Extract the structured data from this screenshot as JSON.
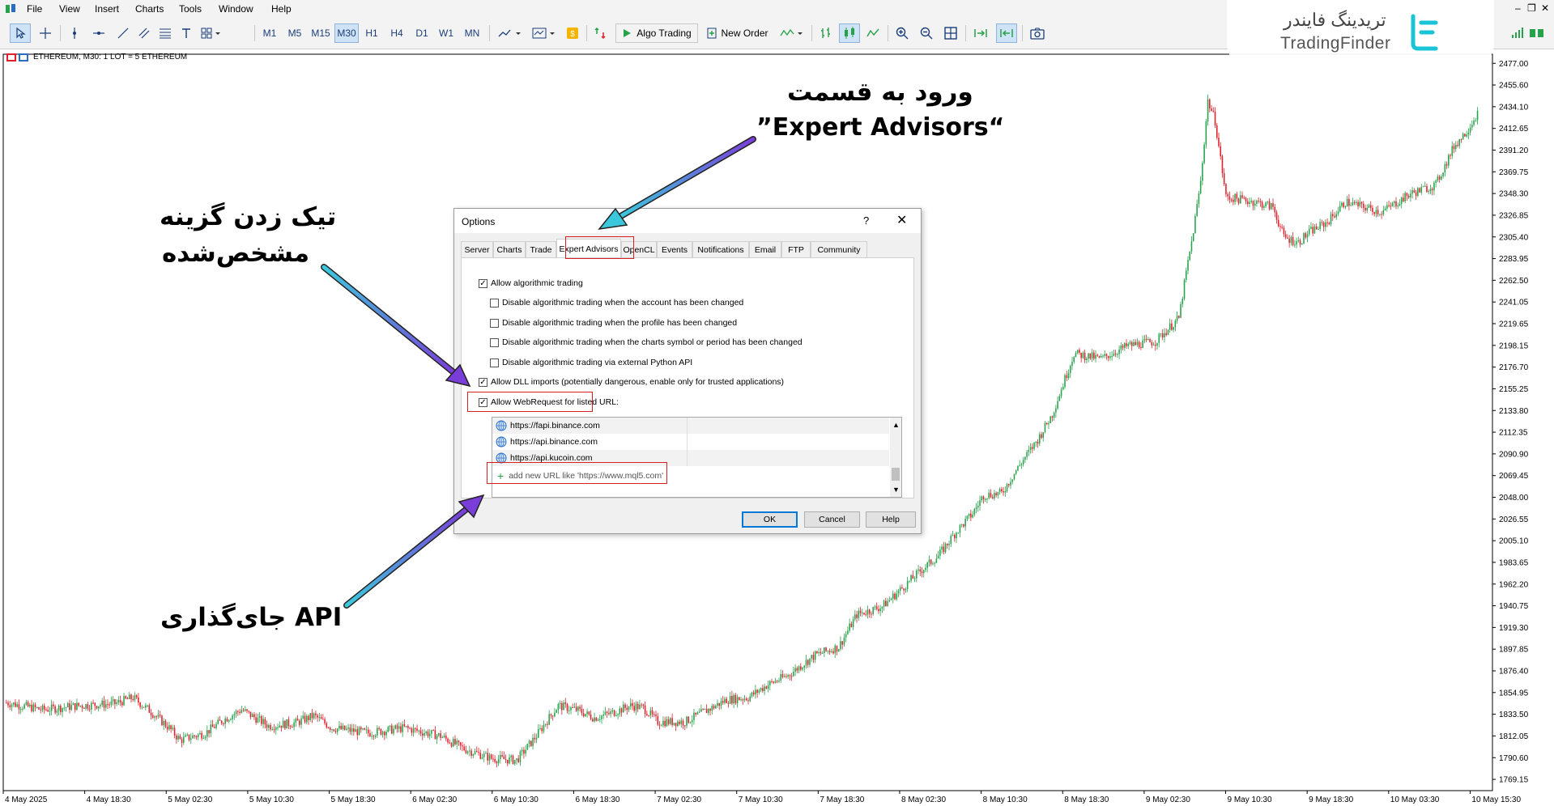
{
  "menu": [
    "File",
    "View",
    "Insert",
    "Charts",
    "Tools",
    "Window",
    "Help"
  ],
  "toolbar": {
    "timeframes": [
      "M1",
      "M5",
      "M15",
      "M30",
      "H1",
      "H4",
      "D1",
      "W1",
      "MN"
    ],
    "active_timeframe": "M30",
    "algo_trading": "Algo Trading",
    "new_order": "New Order"
  },
  "chart": {
    "symbol_label": "ETHEREUM, M30:  1 LOT = 5 ETHEREUM",
    "price_ticks": [
      "2477.00",
      "2455.60",
      "2434.10",
      "2412.65",
      "2391.20",
      "2369.75",
      "2348.30",
      "2326.85",
      "2305.40",
      "2283.95",
      "2262.50",
      "2241.05",
      "2219.65",
      "2198.15",
      "2176.70",
      "2155.25",
      "2133.80",
      "2112.35",
      "2090.90",
      "2069.45",
      "2048.00",
      "2026.55",
      "2005.10",
      "1983.65",
      "1962.20",
      "1940.75",
      "1919.30",
      "1897.85",
      "1876.40",
      "1854.95",
      "1833.50",
      "1812.05",
      "1790.60",
      "1769.15"
    ],
    "time_ticks": [
      "4 May 2025",
      "4 May 18:30",
      "5 May 02:30",
      "5 May 10:30",
      "5 May 18:30",
      "6 May 02:30",
      "6 May 10:30",
      "6 May 18:30",
      "7 May 02:30",
      "7 May 10:30",
      "7 May 18:30",
      "8 May 02:30",
      "8 May 10:30",
      "8 May 18:30",
      "9 May 02:30",
      "9 May 10:30",
      "9 May 18:30",
      "10 May 03:30",
      "10 May 15:30"
    ],
    "bull_color": "#26a24a",
    "bear_color": "#e0202a"
  },
  "chart_data": {
    "type": "candlestick",
    "symbol": "ETHEREUM",
    "timeframe": "M30",
    "ylim": [
      1758,
      2486
    ],
    "close_path": [
      [
        0,
        1845
      ],
      [
        20,
        1838
      ],
      [
        40,
        1842
      ],
      [
        60,
        1844
      ],
      [
        70,
        1850
      ],
      [
        80,
        1836
      ],
      [
        90,
        1820
      ],
      [
        96,
        1808
      ],
      [
        110,
        1815
      ],
      [
        120,
        1828
      ],
      [
        130,
        1838
      ],
      [
        145,
        1822
      ],
      [
        160,
        1825
      ],
      [
        170,
        1832
      ],
      [
        180,
        1820
      ],
      [
        200,
        1815
      ],
      [
        220,
        1820
      ],
      [
        240,
        1812
      ],
      [
        252,
        1800
      ],
      [
        268,
        1790
      ],
      [
        282,
        1788
      ],
      [
        292,
        1810
      ],
      [
        300,
        1830
      ],
      [
        305,
        1842
      ],
      [
        315,
        1838
      ],
      [
        325,
        1830
      ],
      [
        335,
        1835
      ],
      [
        345,
        1842
      ],
      [
        352,
        1840
      ],
      [
        360,
        1826
      ],
      [
        375,
        1826
      ],
      [
        390,
        1840
      ],
      [
        398,
        1848
      ],
      [
        410,
        1850
      ],
      [
        420,
        1862
      ],
      [
        432,
        1872
      ],
      [
        447,
        1892
      ],
      [
        460,
        1900
      ],
      [
        470,
        1932
      ],
      [
        484,
        1940
      ],
      [
        495,
        1958
      ],
      [
        505,
        1975
      ],
      [
        515,
        1990
      ],
      [
        524,
        2012
      ],
      [
        534,
        2032
      ],
      [
        540,
        2050
      ],
      [
        550,
        2052
      ],
      [
        560,
        2080
      ],
      [
        570,
        2105
      ],
      [
        578,
        2130
      ],
      [
        584,
        2160
      ],
      [
        590,
        2190
      ],
      [
        605,
        2185
      ],
      [
        620,
        2198
      ],
      [
        635,
        2202
      ],
      [
        648,
        2225
      ],
      [
        652,
        2270
      ],
      [
        655,
        2300
      ],
      [
        660,
        2360
      ],
      [
        664,
        2440
      ],
      [
        668,
        2420
      ],
      [
        674,
        2345
      ],
      [
        690,
        2340
      ],
      [
        700,
        2335
      ],
      [
        706,
        2305
      ],
      [
        714,
        2300
      ],
      [
        720,
        2310
      ],
      [
        730,
        2320
      ],
      [
        740,
        2340
      ],
      [
        750,
        2335
      ],
      [
        760,
        2330
      ],
      [
        776,
        2348
      ],
      [
        790,
        2357
      ],
      [
        800,
        2395
      ],
      [
        807,
        2410
      ],
      [
        813,
        2428
      ]
    ],
    "candle_count": 814
  },
  "dialog": {
    "title": "Options",
    "help_glyph": "?",
    "close_glyph": "✕",
    "tabs": [
      "Server",
      "Charts",
      "Trade",
      "Expert Advisors",
      "OpenCL",
      "Events",
      "Notifications",
      "Email",
      "FTP",
      "Community"
    ],
    "active_tab": "Expert Advisors",
    "options": [
      {
        "label": "Allow algorithmic trading",
        "checked": true
      },
      {
        "label": "Disable algorithmic trading when the account has been changed",
        "checked": false
      },
      {
        "label": "Disable algorithmic trading when the profile has been changed",
        "checked": false
      },
      {
        "label": "Disable algorithmic trading when the charts symbol or period has been changed",
        "checked": false
      },
      {
        "label": "Disable algorithmic trading via external Python API",
        "checked": false
      },
      {
        "label": "Allow DLL imports (potentially dangerous, enable only for trusted applications)",
        "checked": true
      },
      {
        "label": "Allow WebRequest for listed URL:",
        "checked": true
      }
    ],
    "urls": [
      "https://fapi.binance.com",
      "https://api.binance.com",
      "https://api.kucoin.com"
    ],
    "add_url_placeholder": "add new URL like 'https://www.mql5.com'",
    "buttons": {
      "ok": "OK",
      "cancel": "Cancel",
      "help": "Help"
    }
  },
  "annotations": {
    "expert_line1": "ورود به قسمت",
    "expert_line2": "”Expert Advisors“",
    "tick_line1": "تیک زدن گزینه",
    "tick_line2": "مشخص‌شده",
    "api": "جای‌گذاری API"
  },
  "watermark": {
    "fa": "تریدینگ فایندر",
    "en": "TradingFinder",
    "color": "#19c4d6"
  }
}
